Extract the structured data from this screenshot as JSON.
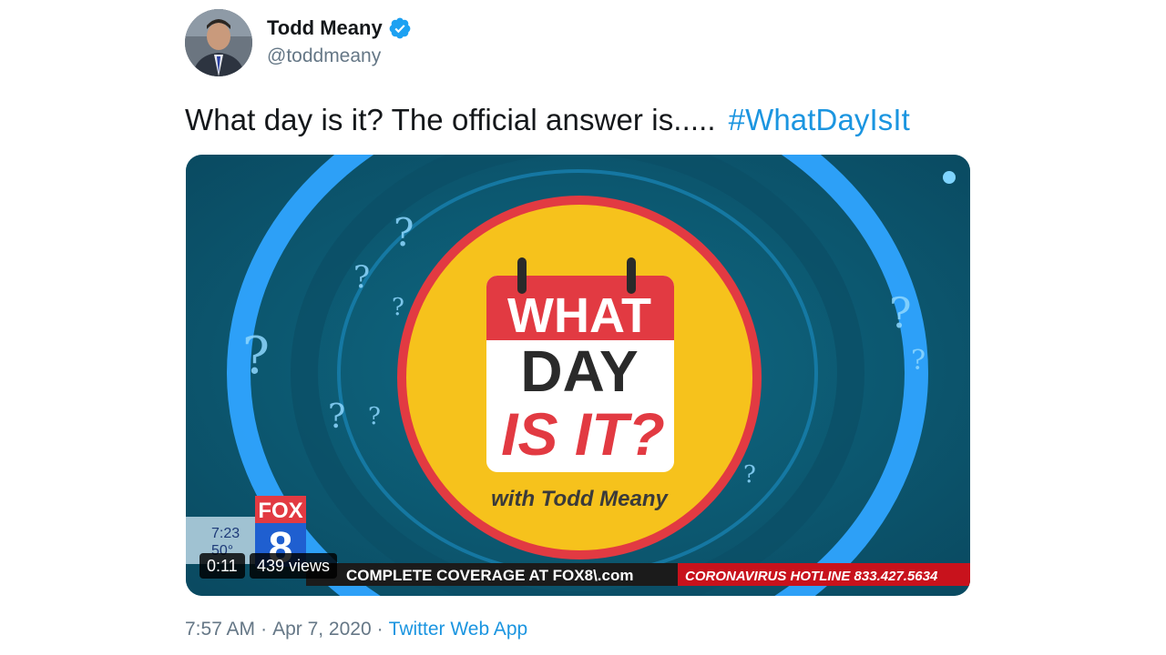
{
  "author": {
    "name": "Todd Meany",
    "handle": "@toddmeany",
    "verified": true
  },
  "tweet": {
    "text": "What day is it?  The official answer is.....",
    "hashtag": "#WhatDayIsIt"
  },
  "video": {
    "elapsed": "0:11",
    "views": "439 views",
    "logo": {
      "line1": "WHAT",
      "line2": "DAY",
      "line3": "IS IT?",
      "byline": "with Todd Meany"
    },
    "station": {
      "network": "FOX",
      "channel": "8",
      "time": "7:23",
      "temp": "50°"
    },
    "ticker": {
      "left": "COMPLETE COVERAGE AT FOX8\\.com",
      "right": "CORONAVIRUS HOTLINE 833.427.5634"
    }
  },
  "meta": {
    "time": "7:57 AM",
    "date": "Apr 7, 2020",
    "source": "Twitter Web App"
  },
  "colors": {
    "link": "#1b95e0",
    "muted": "#657786",
    "teal": "#0c5a72",
    "ring": "#2fa4ff",
    "yellow": "#f6c21c",
    "red": "#e23a42"
  }
}
